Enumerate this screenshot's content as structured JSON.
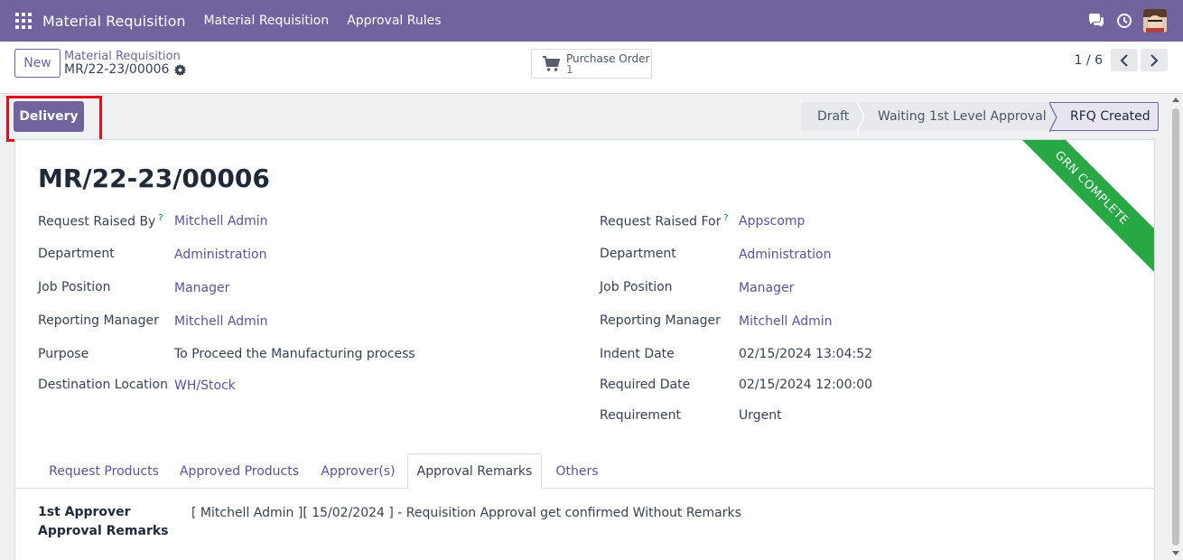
{
  "navbar": {
    "brand": "Material Requisition",
    "links": [
      "Material Requisition",
      "Approval Rules"
    ],
    "color": "#71639e"
  },
  "control": {
    "new_label": "New",
    "breadcrumb_parent": "Material Requisition",
    "breadcrumb_current": "MR/22-23/00006",
    "smart_button": {
      "label": "Purchase Order",
      "count": "1",
      "icon": "cart-icon"
    },
    "pager": "1 / 6"
  },
  "actions": {
    "delivery_label": "Delivery"
  },
  "statusbar": {
    "stages": [
      "Draft",
      "Waiting 1st Level Approval",
      "RFQ Created"
    ],
    "current": "RFQ Created"
  },
  "record": {
    "title": "MR/22-23/00006",
    "ribbon": "GRN COMPLETE",
    "ribbon_color": "#28a745",
    "left": [
      {
        "label": "Request Raised By",
        "value": "Mitchell Admin",
        "help": "?"
      },
      {
        "label": "Department",
        "value": "Administration"
      },
      {
        "label": "Job Position",
        "value": "Manager"
      },
      {
        "label": "Reporting Manager",
        "value": "Mitchell Admin"
      },
      {
        "label": "Purpose",
        "value": "To Proceed the Manufacturing process"
      },
      {
        "label": "Destination Location",
        "value": "WH/Stock"
      }
    ],
    "right": [
      {
        "label": "Request Raised For",
        "value": "Appscomp",
        "help": "?"
      },
      {
        "label": "Department",
        "value": "Administration"
      },
      {
        "label": "Job Position",
        "value": "Manager"
      },
      {
        "label": "Reporting Manager",
        "value": "Mitchell Admin"
      },
      {
        "label": "Indent Date",
        "value": "02/15/2024 13:04:52"
      },
      {
        "label": "Required Date",
        "value": "02/15/2024 12:00:00"
      },
      {
        "label": "Requirement",
        "value": "Urgent"
      }
    ]
  },
  "tabs": [
    "Request Products",
    "Approved Products",
    "Approver(s)",
    "Approval Remarks",
    "Others"
  ],
  "active_tab": "Approval Remarks",
  "remarks": {
    "label": "1st Approver Approval Remarks",
    "value": "[ Mitchell Admin ][ 15/02/2024 ] - Requisition Approval get confirmed Without Remarks"
  }
}
